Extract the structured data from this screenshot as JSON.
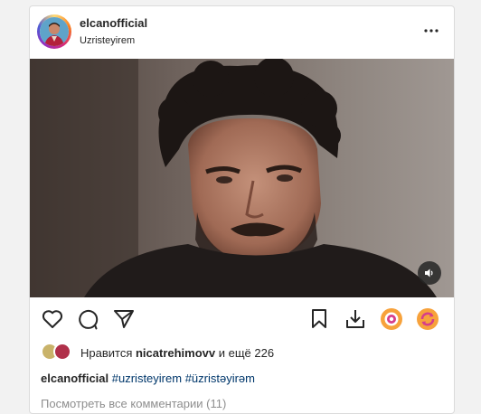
{
  "post": {
    "username": "elcanofficial",
    "subtitle": "Uzristeyirem",
    "more_icon": "more-horizontal-icon",
    "sound_icon": "speaker-icon"
  },
  "actions": {
    "like_icon": "heart-icon",
    "comment_icon": "comment-icon",
    "share_icon": "send-icon",
    "save_icon": "bookmark-icon",
    "download_icon": "download-icon",
    "ext1_icon": "extension-orange-icon",
    "ext2_icon": "extension-orange-refresh-icon"
  },
  "likes": {
    "prefix": "Нравится ",
    "user": "nicatrehimovv",
    "suffix": " и ещё 226"
  },
  "caption": {
    "username": "elcanofficial",
    "tags": [
      "#uzristeyirem",
      "#üzristəyirəm"
    ]
  },
  "comments": {
    "label": "Посмотреть все комментарии (11)"
  },
  "colors": {
    "accent_link": "#00376b",
    "extension": "#f7a23b"
  }
}
